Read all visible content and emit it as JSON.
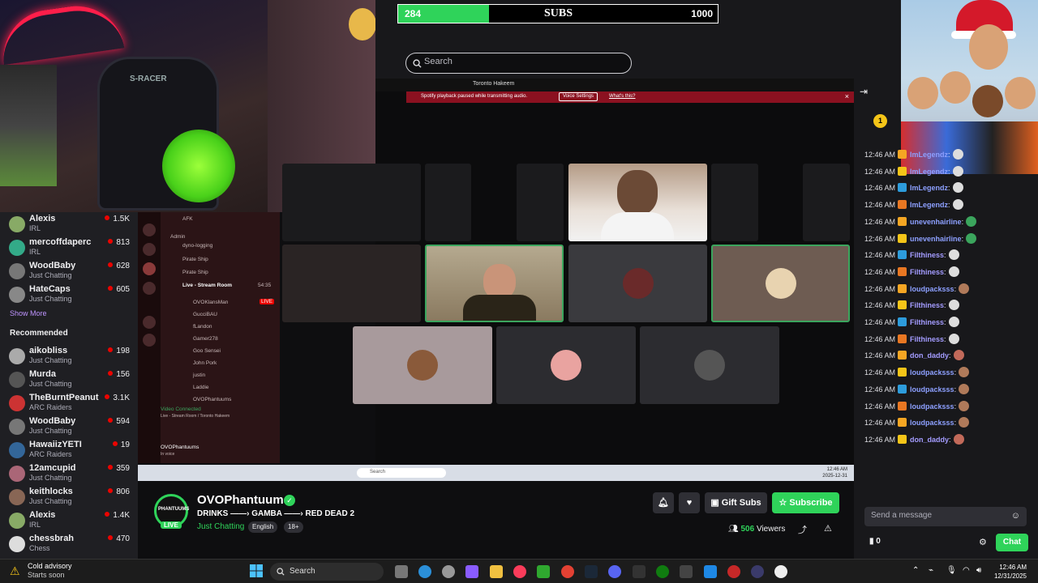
{
  "subs_goal": {
    "current": "284",
    "label": "SUBS",
    "goal": "1000",
    "progress": 0.284
  },
  "site_search": {
    "placeholder": "Search"
  },
  "followed": [
    {
      "name": "Alexis",
      "game": "IRL",
      "viewers": "1.5K"
    },
    {
      "name": "mercoffdaperc",
      "game": "IRL",
      "viewers": "813"
    },
    {
      "name": "WoodBaby",
      "game": "Just Chatting",
      "viewers": "628"
    },
    {
      "name": "HateCaps",
      "game": "Just Chatting",
      "viewers": "605"
    }
  ],
  "show_more": "Show More",
  "recommended_heading": "Recommended",
  "recommended": [
    {
      "name": "aikobliss",
      "game": "Just Chatting",
      "viewers": "198"
    },
    {
      "name": "Murda",
      "game": "Just Chatting",
      "viewers": "156"
    },
    {
      "name": "TheBurntPeanut",
      "game": "ARC Raiders",
      "viewers": "3.1K"
    },
    {
      "name": "WoodBaby",
      "game": "Just Chatting",
      "viewers": "594"
    },
    {
      "name": "HawaiizYETI",
      "game": "ARC Raiders",
      "viewers": "19"
    },
    {
      "name": "12amcupid",
      "game": "Just Chatting",
      "viewers": "359"
    },
    {
      "name": "keithlocks",
      "game": "Just Chatting",
      "viewers": "806"
    },
    {
      "name": "Alexis",
      "game": "IRL",
      "viewers": "1.4K"
    },
    {
      "name": "chessbrah",
      "game": "Chess",
      "viewers": "470"
    }
  ],
  "discord": {
    "window_title": "Toronto Hakeem",
    "notice": "Spotify playback paused while transmitting audio.",
    "notice_button": "Voice Settings",
    "notice_link": "What's this?",
    "channels": [
      "AFK",
      "Admin",
      "dyno-logging",
      "Pirate Ship",
      "Pirate Ship",
      "Live - Stream Room"
    ],
    "members": [
      "OVOKlansMan",
      "GucciBAU",
      "fLandon",
      "Gamer278",
      "Goo Sensei",
      "John Pork",
      "justin",
      "Laddie",
      "OVOPhantuums"
    ],
    "member_badge": "LIVE",
    "channel_time": "54:35",
    "voice_status": "Video Connected",
    "voice_sub": "Live - Stream Room / Toronto Hakeem",
    "user": "OVOPhantuums",
    "user_sub": "In voice"
  },
  "video_taskbar": {
    "search": "Search",
    "time": "12:46 AM",
    "date": "2025-12-31"
  },
  "stream": {
    "logo_text": "PHANTUUMS",
    "live": "LIVE",
    "name": "OVOPhantuums",
    "title": "DRINKS ——› GAMBA ——› RED DEAD 2",
    "category": "Just Chatting",
    "tags": [
      "English",
      "18+"
    ],
    "gift_label": "Gift Subs",
    "subscribe_label": "Subscribe",
    "viewers": "506",
    "viewers_label": "Viewers"
  },
  "chat": {
    "leaderboard_rank": "1",
    "messages": [
      {
        "time": "12:46 AM",
        "user": "ImLegendz",
        "color": "#8da0ff"
      },
      {
        "time": "12:46 AM",
        "user": "ImLegendz",
        "color": "#8da0ff"
      },
      {
        "time": "12:46 AM",
        "user": "ImLegendz",
        "color": "#8da0ff"
      },
      {
        "time": "12:46 AM",
        "user": "ImLegendz",
        "color": "#8da0ff"
      },
      {
        "time": "12:46 AM",
        "user": "unevenhairline",
        "color": "#8da0ff"
      },
      {
        "time": "12:46 AM",
        "user": "unevenhairline",
        "color": "#8da0ff"
      },
      {
        "time": "12:46 AM",
        "user": "Filthiness",
        "color": "#a49cff"
      },
      {
        "time": "12:46 AM",
        "user": "Filthiness",
        "color": "#a49cff"
      },
      {
        "time": "12:46 AM",
        "user": "loudpacksss",
        "color": "#8da0ff"
      },
      {
        "time": "12:46 AM",
        "user": "Filthiness",
        "color": "#a49cff"
      },
      {
        "time": "12:46 AM",
        "user": "Filthiness",
        "color": "#a49cff"
      },
      {
        "time": "12:46 AM",
        "user": "Filthiness",
        "color": "#a49cff"
      },
      {
        "time": "12:46 AM",
        "user": "don_daddy",
        "color": "#a49cff"
      },
      {
        "time": "12:46 AM",
        "user": "loudpacksss",
        "color": "#8da0ff"
      },
      {
        "time": "12:46 AM",
        "user": "loudpacksss",
        "color": "#8da0ff"
      },
      {
        "time": "12:46 AM",
        "user": "loudpacksss",
        "color": "#8da0ff"
      },
      {
        "time": "12:46 AM",
        "user": "loudpacksss",
        "color": "#8da0ff"
      },
      {
        "time": "12:46 AM",
        "user": "don_daddy",
        "color": "#a49cff"
      }
    ],
    "input_placeholder": "Send a message",
    "points": "0",
    "send_label": "Chat"
  },
  "taskbar": {
    "weather_title": "Cold advisory",
    "weather_sub": "Starts soon",
    "search": "Search",
    "time": "12:46 AM",
    "date": "12/31/2025"
  },
  "colors": {
    "accent": "#2fd35a",
    "twitch_purple": "#bf94ff",
    "live_red": "#eb0400"
  }
}
